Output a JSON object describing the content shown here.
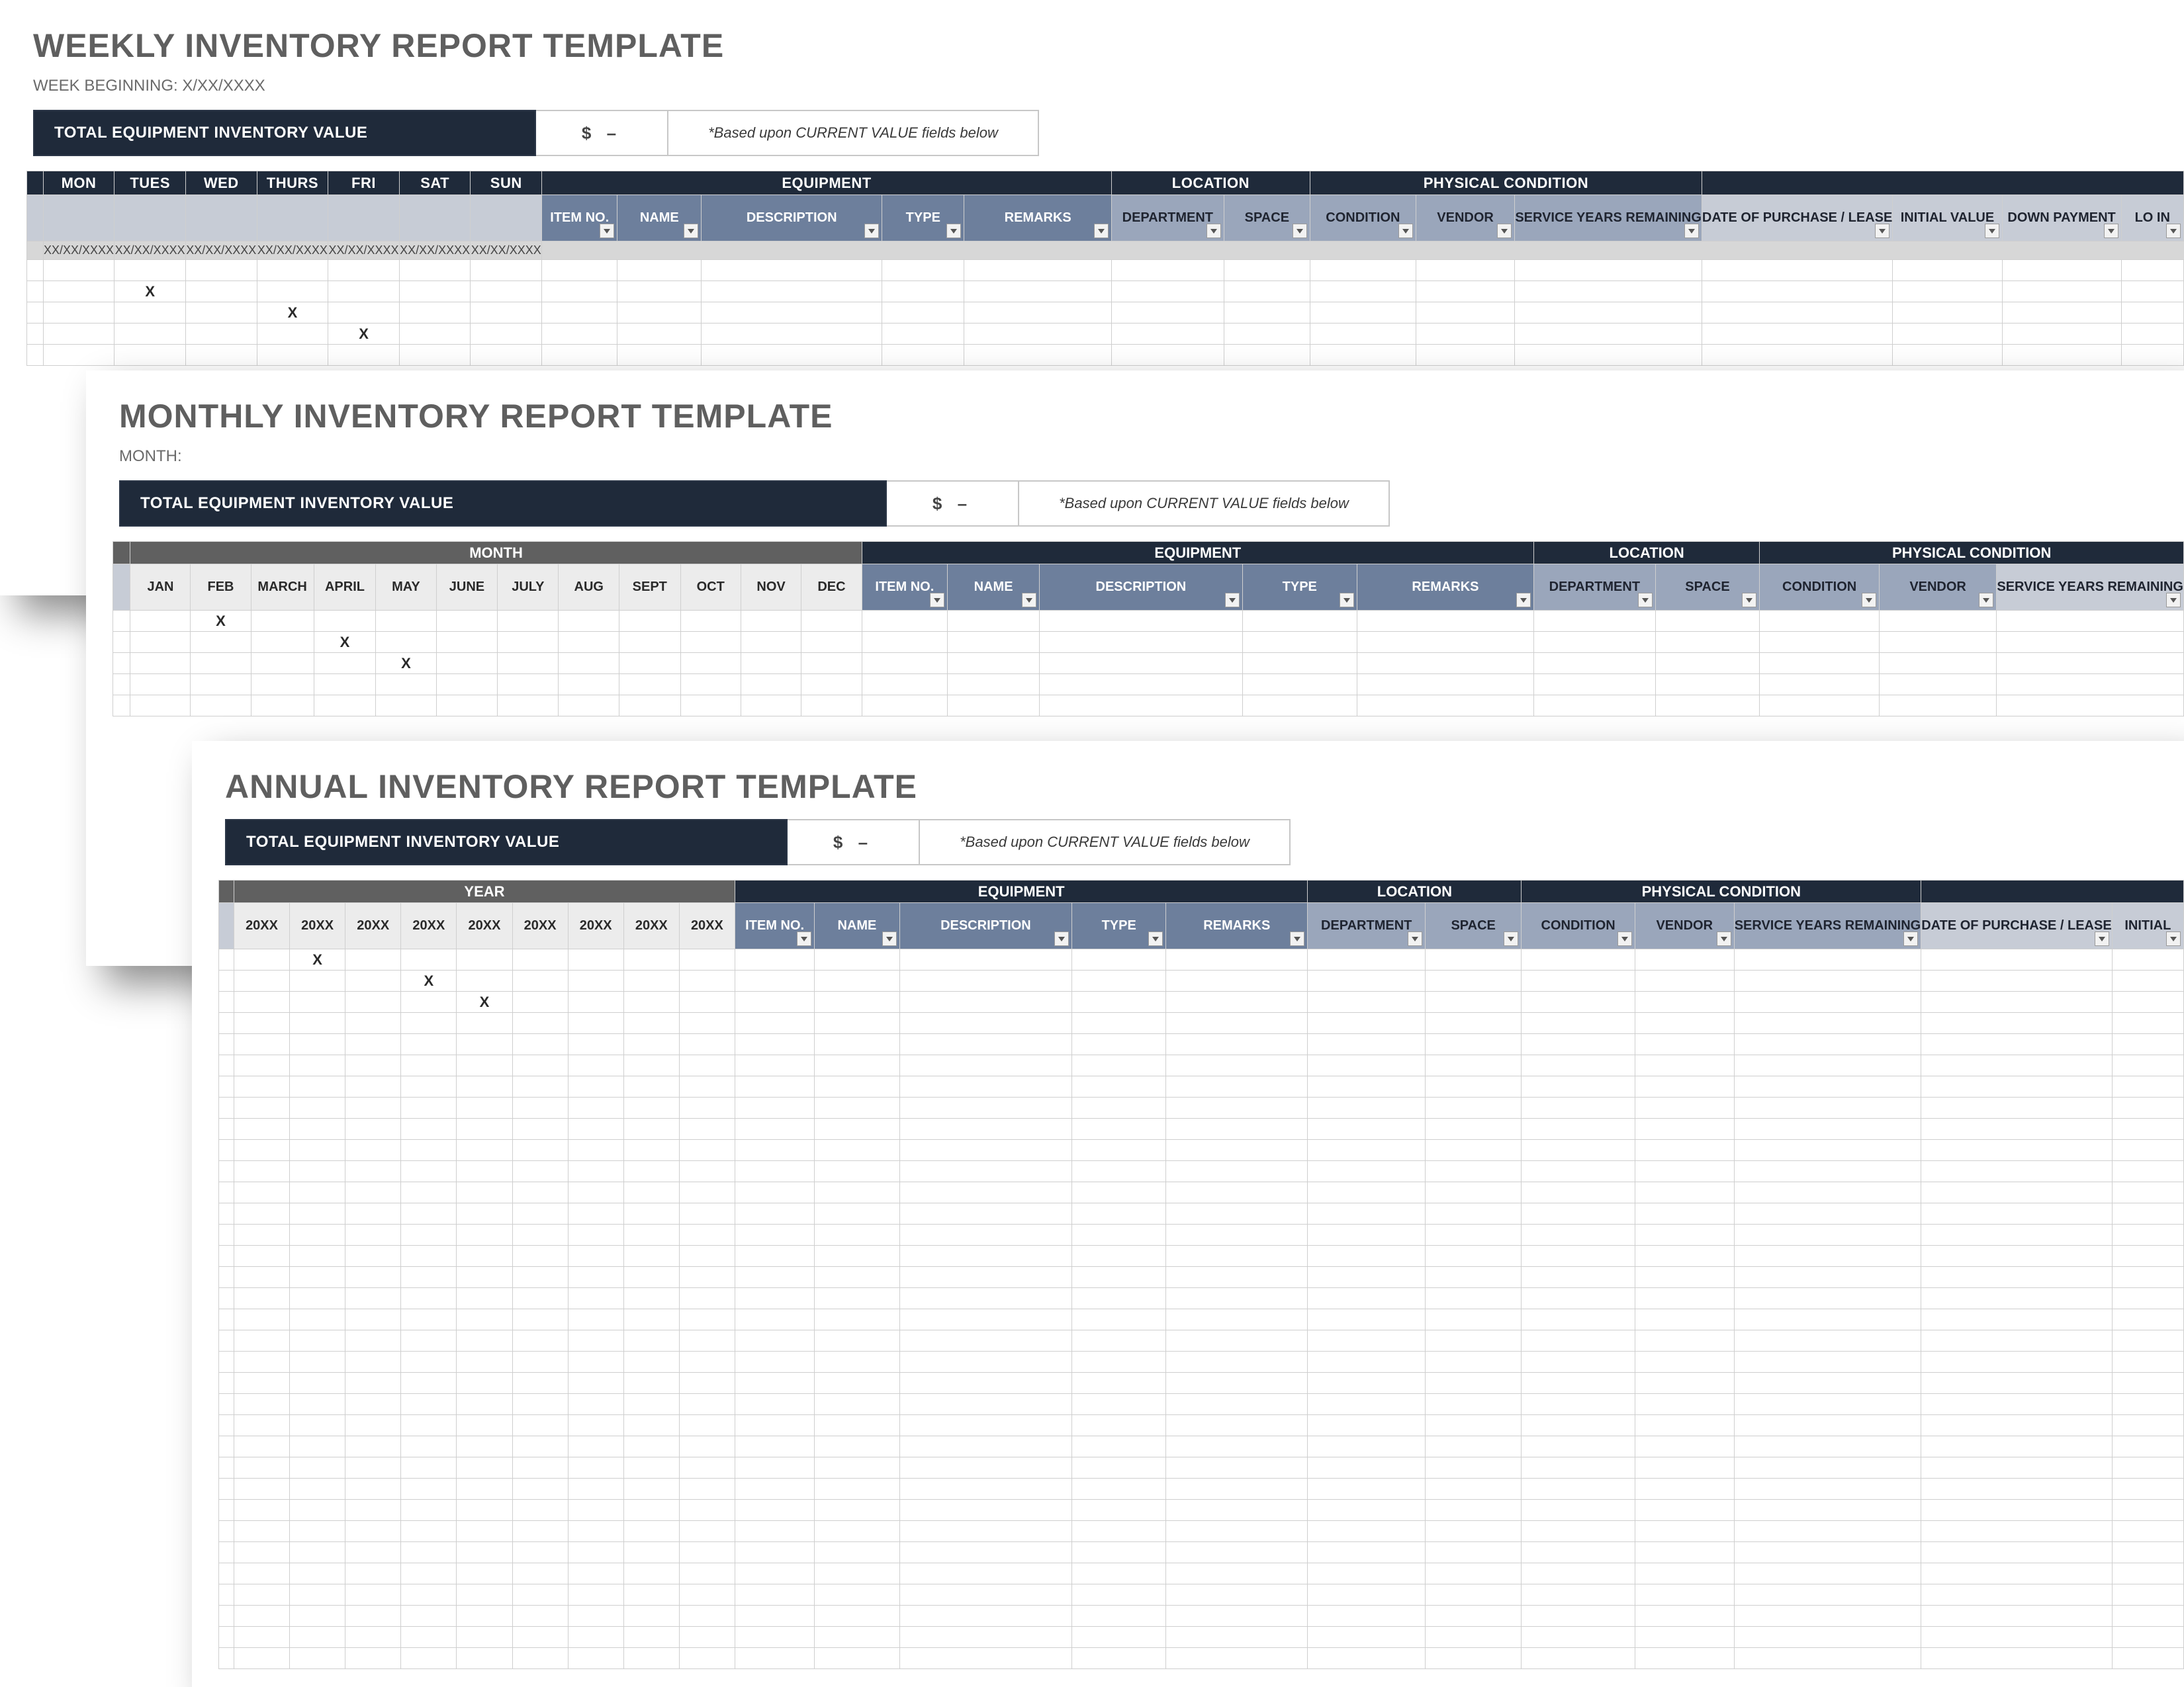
{
  "common": {
    "tiv_label": "TOTAL EQUIPMENT INVENTORY VALUE",
    "tiv_value": "$   –",
    "tiv_note": "*Based upon CURRENT VALUE fields below",
    "group_equipment": "EQUIPMENT",
    "group_location": "LOCATION",
    "group_condition": "PHYSICAL CONDITION",
    "equipment_cols": [
      "ITEM NO.",
      "NAME",
      "DESCRIPTION",
      "TYPE",
      "REMARKS"
    ],
    "location_cols": [
      "DEPARTMENT",
      "SPACE"
    ],
    "condition_cols": [
      "CONDITION",
      "VENDOR",
      "SERVICE YEARS REMAINING"
    ]
  },
  "weekly": {
    "title": "WEEKLY INVENTORY REPORT TEMPLATE",
    "subtitle": "WEEK BEGINNING: X/XX/XXXX",
    "period_cols": [
      "MON",
      "TUES",
      "WED",
      "THURS",
      "FRI",
      "SAT",
      "SUN"
    ],
    "period_sub": "XX/XX/XXXX",
    "extra_cols": [
      "DATE OF PURCHASE / LEASE",
      "INITIAL VALUE",
      "DOWN PAYMENT",
      "LO IN"
    ],
    "x_marks": [
      [
        1,
        1
      ],
      [
        2,
        3
      ],
      [
        3,
        4
      ]
    ]
  },
  "monthly": {
    "title": "MONTHLY INVENTORY REPORT TEMPLATE",
    "subtitle": "MONTH:",
    "period_group": "MONTH",
    "period_cols": [
      "JAN",
      "FEB",
      "MARCH",
      "APRIL",
      "MAY",
      "JUNE",
      "JULY",
      "AUG",
      "SEPT",
      "OCT",
      "NOV",
      "DEC"
    ],
    "extra_cols": [
      "SERVICE YEARS REMAINING"
    ],
    "x_marks": [
      [
        0,
        1
      ],
      [
        1,
        3
      ],
      [
        2,
        4
      ]
    ]
  },
  "annual": {
    "title": "ANNUAL INVENTORY REPORT TEMPLATE",
    "period_group": "YEAR",
    "period_cols": [
      "20XX",
      "20XX",
      "20XX",
      "20XX",
      "20XX",
      "20XX",
      "20XX",
      "20XX",
      "20XX"
    ],
    "extra_cols": [
      "DATE OF PURCHASE / LEASE",
      "INITIAL"
    ],
    "x_marks": [
      [
        0,
        1
      ],
      [
        1,
        3
      ],
      [
        2,
        4
      ]
    ]
  }
}
